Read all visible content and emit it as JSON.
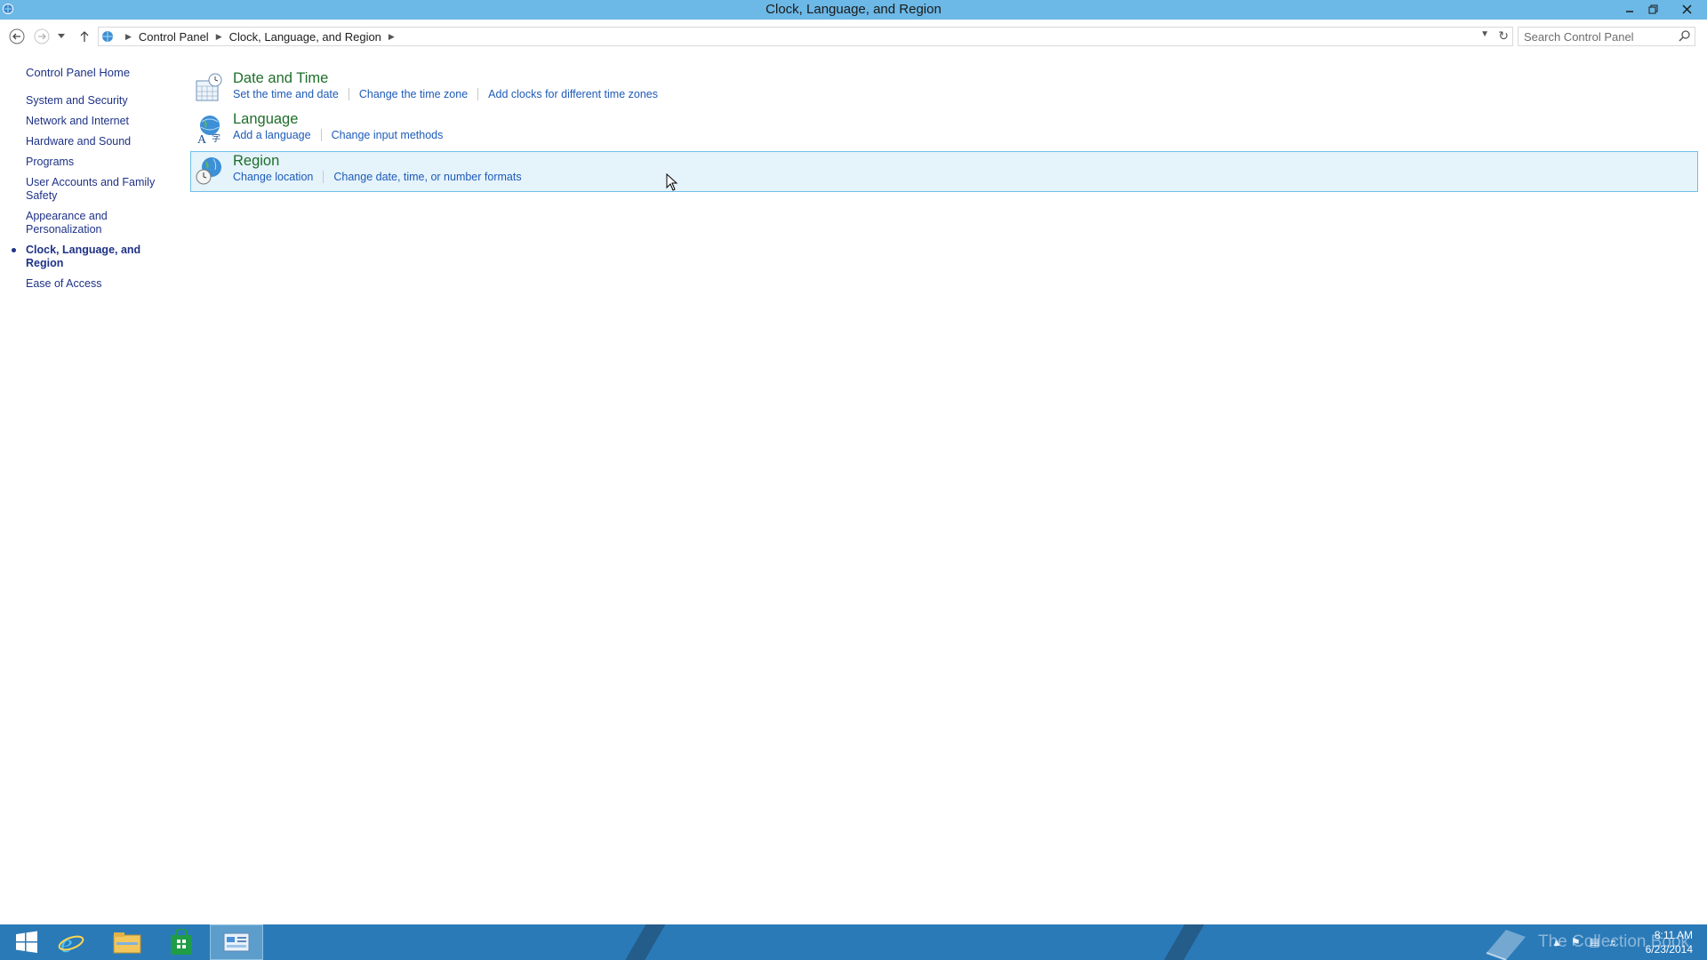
{
  "window": {
    "title": "Clock, Language, and Region"
  },
  "address": {
    "crumbs": [
      "Control Panel",
      "Clock, Language, and Region"
    ]
  },
  "search": {
    "placeholder": "Search Control Panel"
  },
  "leftnav": {
    "home": "Control Panel Home",
    "items": [
      {
        "label": "System and Security"
      },
      {
        "label": "Network and Internet"
      },
      {
        "label": "Hardware and Sound"
      },
      {
        "label": "Programs"
      },
      {
        "label": "User Accounts and Family Safety"
      },
      {
        "label": "Appearance and Personalization"
      },
      {
        "label": "Clock, Language, and Region",
        "current": true
      },
      {
        "label": "Ease of Access"
      }
    ]
  },
  "categories": [
    {
      "heading": "Date and Time",
      "icon": "clock-calendar-icon",
      "links": [
        "Set the time and date",
        "Change the time zone",
        "Add clocks for different time zones"
      ]
    },
    {
      "heading": "Language",
      "icon": "language-globe-icon",
      "links": [
        "Add a language",
        "Change input methods"
      ]
    },
    {
      "heading": "Region",
      "icon": "region-globe-icon",
      "links": [
        "Change location",
        "Change date, time, or number formats"
      ],
      "hovered": true
    }
  ],
  "taskbar": {
    "apps": [
      "start-icon",
      "internet-explorer-icon",
      "file-explorer-icon",
      "store-icon",
      "control-panel-icon"
    ],
    "watermark": "The Collection Book",
    "time": "8:11 AM",
    "date": "6/23/2014"
  },
  "colors": {
    "titlebar": "#6cb8e6",
    "taskbar": "#2a7ab8",
    "link": "#1e5bb8",
    "heading": "#1e6e2a",
    "highlight": "#e5f3fb"
  }
}
